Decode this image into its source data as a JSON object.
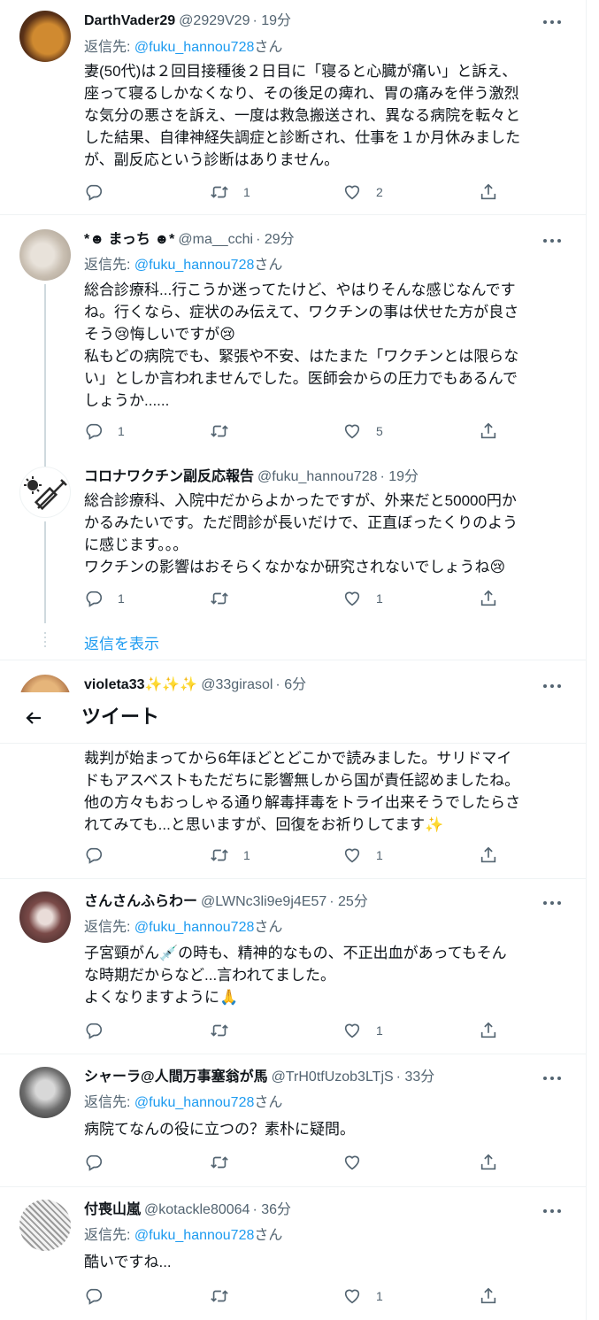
{
  "header": {
    "title": "ツイート"
  },
  "reply_prefix": "返信先: ",
  "reply_suffix": "さん",
  "show_replies": "返信を表示",
  "tweets": [
    {
      "name": "DarthVader29",
      "handle": "@2929V29",
      "time": "· 19分",
      "reply_to": "@fuku_hannou728",
      "text": "妻(50代)は２回目接種後２日目に「寝ると心臓が痛い」と訴え、\n座って寝るしかなくなり、その後足の痺れ、胃の痛みを伴う激烈\nな気分の悪さを訴え、一度は救急搬送され、異なる病院を転々と\nした結果、自律神経失調症と診断され、仕事を１か月休みました\nが、副反応という診断はありません。",
      "replies": "",
      "retweets": "1",
      "likes": "2"
    },
    {
      "name": "*☻ まっち ☻*",
      "handle": "@ma__cchi",
      "time": "· 29分",
      "reply_to": "@fuku_hannou728",
      "text": "総合診療科...行こうか迷ってたけど、やはりそんな感じなんです\nね。行くなら、症状のみ伝えて、ワクチンの事は伏せた方が良さ\nそう😢悔しいですが😢\n私もどの病院でも、緊張や不安、はたまた「ワクチンとは限らな\nい」としか言われませんでした。医師会からの圧力でもあるんで\nしょうか......",
      "replies": "1",
      "retweets": "",
      "likes": "5"
    },
    {
      "name": "コロナワクチン副反応報告",
      "handle": "@fuku_hannou728",
      "time": "· 19分",
      "reply_to": "",
      "text": "総合診療科、入院中だからよかったですが、外来だと50000円か\nかるみたいです。ただ問診が長いだけで、正直ぼったくりのよう\nに感じます。。。\nワクチンの影響はおそらくなかなか研究されないでしょうね😢",
      "replies": "1",
      "retweets": "",
      "likes": "1"
    },
    {
      "name": "violeta33✨✨✨",
      "handle": "@33girasol",
      "time": "· 6分",
      "reply_to": "",
      "text": "裁判が始まってから6年ほどとどこかで読みました。サリドマイ\nドもアスベストもただちに影響無しから国が責任認めましたね。\n他の方々もおっしゃる通り解毒拝毒をトライ出来そうでしたらさ\nれてみても...と思いますが、回復をお祈りしてます✨",
      "replies": "",
      "retweets": "1",
      "likes": "1"
    },
    {
      "name": "さんさんふらわー",
      "handle": "@LWNc3li9e9j4E57",
      "time": "· 25分",
      "reply_to": "@fuku_hannou728",
      "text": "子宮頸がん💉の時も、精神的なもの、不正出血があってもそん\nな時期だからなど...言われてました。\nよくなりますように🙏",
      "replies": "",
      "retweets": "",
      "likes": "1"
    },
    {
      "name": "シャーラ@人間万事塞翁が馬",
      "handle": "@TrH0tfUzob3LTjS",
      "time": "· 33分",
      "reply_to": "@fuku_hannou728",
      "text": "病院てなんの役に立つの？素朴に疑問。",
      "replies": "",
      "retweets": "",
      "likes": ""
    },
    {
      "name": "付喪山嵐",
      "handle": "@kotackle80064",
      "time": "· 36分",
      "reply_to": "@fuku_hannou728",
      "text": "酷いですね...",
      "replies": "",
      "retweets": "",
      "likes": "1"
    }
  ],
  "icons": [
    "reply-icon",
    "retweet-icon",
    "like-icon",
    "share-icon",
    "more-icon",
    "back-arrow-icon"
  ],
  "colors": {
    "accent": "#1d9bf0",
    "muted": "#536471",
    "text": "#0f1419",
    "divider": "#eff3f4"
  }
}
